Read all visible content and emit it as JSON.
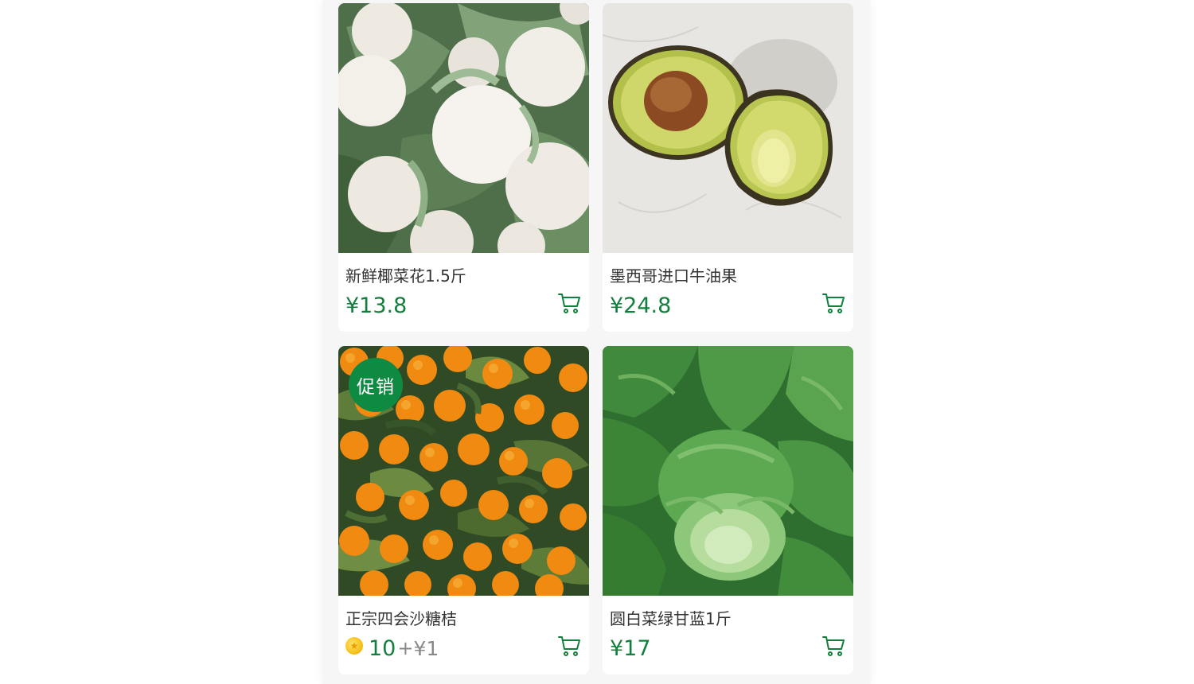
{
  "products": [
    {
      "name": "新鲜椰菜花1.5斤",
      "price": "¥13.8",
      "image": "cauliflower",
      "badge": "",
      "icon": "cart-icon"
    },
    {
      "name": "墨西哥进口牛油果",
      "price": "¥24.8",
      "image": "avocado",
      "badge": "",
      "icon": "cart-icon"
    },
    {
      "name": "正宗四会沙糖桔",
      "coins": "10",
      "plus": "+",
      "cash": "¥1",
      "image": "mandarin-oranges",
      "badge": "促销",
      "icon": "cart-icon"
    },
    {
      "name": "圆白菜绿甘蓝1斤",
      "price": "¥17",
      "image": "cabbage",
      "badge": "",
      "icon": "cart-icon"
    }
  ],
  "colors": {
    "accent_green": "#12803c",
    "badge_green": "#0f8a43",
    "title_text": "#333333",
    "muted_text": "#888888",
    "coin_gold": "#f7c11c"
  }
}
